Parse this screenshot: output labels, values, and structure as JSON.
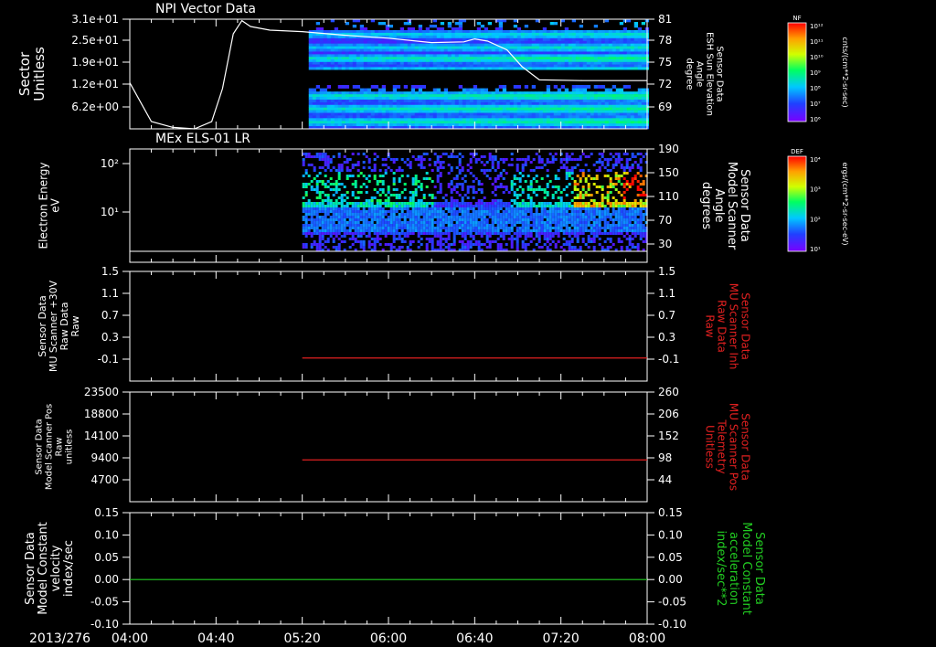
{
  "time_axis": {
    "date_label": "2013/276",
    "ticks": [
      "04:00",
      "04:40",
      "05:20",
      "06:00",
      "06:40",
      "07:20",
      "08:00"
    ],
    "range": [
      "04:00",
      "08:00"
    ]
  },
  "colorbars": [
    {
      "tag": "NF",
      "unit": "cnts/(cm**2-sr-sec)",
      "ticks": [
        "10¹²",
        "10¹¹",
        "10¹⁰",
        "10⁹",
        "10⁸",
        "10⁷",
        "10⁶"
      ]
    },
    {
      "tag": "DEF",
      "unit": "ergs/(cm**2-sr-sec-eV)",
      "ticks": [
        "10⁴",
        "10³",
        "10²",
        "10¹"
      ]
    }
  ],
  "chart_data": [
    {
      "type": "heatmap",
      "title": "NPI Vector Data",
      "ylabel": [
        "Sector",
        "Unitless"
      ],
      "yticks": [
        "3.1e+01",
        "2.5e+01",
        "1.9e+01",
        "1.2e+01",
        "6.2e+00"
      ],
      "ylim": [
        0,
        31
      ],
      "y2label": [
        "Sensor Data",
        "ESH Sun Elevation",
        "Angle",
        "degree"
      ],
      "y2ticks": [
        "81",
        "78",
        "75",
        "72",
        "69"
      ],
      "y2lim": [
        66,
        81
      ],
      "spectrogram_start": "05:23",
      "overlay_line": {
        "color": "#ffffff",
        "x": [
          "04:00",
          "04:10",
          "04:20",
          "04:30",
          "04:38",
          "04:43",
          "04:48",
          "04:52",
          "04:56",
          "05:05",
          "05:20",
          "05:40",
          "06:00",
          "06:20",
          "06:35",
          "06:40",
          "06:46",
          "06:55",
          "07:02",
          "07:10",
          "07:30",
          "08:00"
        ],
        "y": [
          72.3,
          67.0,
          66.2,
          66.0,
          67.0,
          71.5,
          79.0,
          80.8,
          80.0,
          79.5,
          79.3,
          78.8,
          78.4,
          77.8,
          77.9,
          78.3,
          78.0,
          76.8,
          74.5,
          72.7,
          72.6,
          72.6
        ]
      }
    },
    {
      "type": "heatmap",
      "title": "MEx ELS-01 LR",
      "ylabel": [
        "Electron Energy",
        "eV"
      ],
      "yticks": [
        "10²",
        "10¹"
      ],
      "ylog": true,
      "y2label": [
        "Sensor Data",
        "Model Scanner",
        "Angle",
        "degrees"
      ],
      "y2ticks": [
        "190",
        "150",
        "110",
        "70",
        "30"
      ],
      "y2lim": [
        0,
        190
      ],
      "spectrogram_start": "05:20",
      "overlay_line": {
        "color": "#ffffff",
        "x": [
          "04:00",
          "08:00"
        ],
        "y": [
          7,
          7
        ]
      }
    },
    {
      "type": "line",
      "ylabel": [
        "Sensor Data",
        "MU Scanner +30V",
        "Raw Data",
        "Raw"
      ],
      "yticks": [
        "1.5",
        "1.1",
        "0.7",
        "0.3",
        "-0.1"
      ],
      "ylim": [
        -0.4,
        1.5
      ],
      "y2label": [
        "Sensor Data",
        "MU Scanner Inh",
        "Raw Data",
        "Raw"
      ],
      "y2ticks": [
        "1.5",
        "1.1",
        "0.7",
        "0.3",
        "-0.1"
      ],
      "series": [
        {
          "color": "#e02020",
          "x": [
            "05:20",
            "08:00"
          ],
          "y": [
            0.0,
            0.0
          ]
        }
      ]
    },
    {
      "type": "line",
      "ylabel": [
        "Sensor Data",
        "Model Scanner Pos",
        "Raw",
        "unitless"
      ],
      "yticks": [
        "23500",
        "18800",
        "14100",
        "9400",
        "4700"
      ],
      "ylim": [
        1000,
        23500
      ],
      "y2label": [
        "Sensor Data",
        "MU Scanner Pos",
        "Telemetry",
        "Unitless"
      ],
      "y2ticks": [
        "260",
        "206",
        "152",
        "98",
        "44"
      ],
      "y2lim": [
        11,
        260
      ],
      "series": [
        {
          "color": "#e02020",
          "x": [
            "05:20",
            "08:00"
          ],
          "y": [
            92,
            92
          ]
        }
      ]
    },
    {
      "type": "line",
      "ylabel": [
        "Sensor Data",
        "Model Constant",
        "velocity",
        "index/sec"
      ],
      "yticks": [
        "0.15",
        "0.10",
        "0.05",
        "0.00",
        "-0.05",
        "-0.10"
      ],
      "ylim": [
        -0.1,
        0.15
      ],
      "y2label": [
        "Sensor Data",
        "Model Constant",
        "acceleration",
        "index/sec**2"
      ],
      "y2ticks": [
        "0.15",
        "0.10",
        "0.05",
        "0.00",
        "-0.05",
        "-0.10"
      ],
      "series": [
        {
          "color": "#22cc22",
          "x": [
            "04:00",
            "08:00"
          ],
          "y": [
            0.0,
            0.0
          ]
        }
      ]
    }
  ]
}
